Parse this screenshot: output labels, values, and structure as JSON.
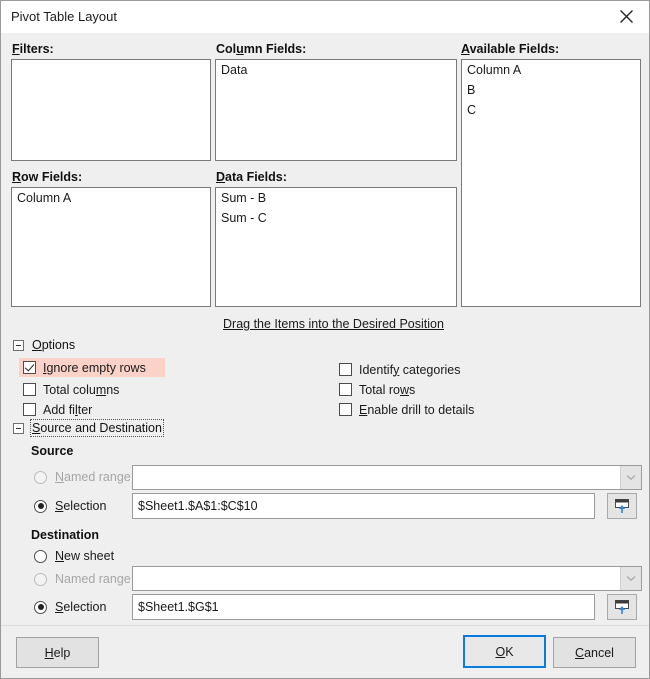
{
  "window": {
    "title": "Pivot Table Layout",
    "close_icon": "close-icon"
  },
  "layout_areas": {
    "filters": {
      "label": "Filters:",
      "label_mnemonic": "F",
      "items": []
    },
    "column_fields": {
      "label": "Column Fields:",
      "label_mnemonic": "u",
      "items": [
        "Data"
      ]
    },
    "available_fields": {
      "label": "Available Fields:",
      "label_mnemonic": "A",
      "items": [
        "Column A",
        "B",
        "C"
      ]
    },
    "row_fields": {
      "label": "Row Fields:",
      "label_mnemonic": "R",
      "items": [
        "Column A"
      ]
    },
    "data_fields": {
      "label": "Data Fields:",
      "label_mnemonic": "D",
      "items": [
        "Sum - B",
        "Sum - C"
      ]
    },
    "drag_hint": "Drag the Items into the Desired Position"
  },
  "options": {
    "section_label": "Options",
    "section_mnemonic": "O",
    "expanded": true,
    "highlight_color": "#fbd2c8",
    "left_column": [
      {
        "label": "Ignore empty rows",
        "mnemonic": "I",
        "checked": true,
        "highlighted": true
      },
      {
        "label": "Total columns",
        "mnemonic": "m",
        "checked": false,
        "highlighted": false
      },
      {
        "label": "Add filter",
        "mnemonic": "l",
        "checked": false,
        "highlighted": false
      }
    ],
    "right_column": [
      {
        "label": "Identify categories",
        "mnemonic": "y",
        "checked": false,
        "highlighted": false
      },
      {
        "label": "Total rows",
        "mnemonic": "w",
        "checked": false,
        "highlighted": false
      },
      {
        "label": "Enable drill to details",
        "mnemonic": "E",
        "checked": false,
        "highlighted": false
      }
    ]
  },
  "source_destination": {
    "section_label": "Source and Destination",
    "section_mnemonic": "S",
    "expanded": true,
    "focused": true,
    "source": {
      "heading": "Source",
      "named_range": {
        "label": "Named range",
        "mnemonic": "N",
        "selected": false,
        "disabled": true,
        "value": ""
      },
      "selection": {
        "label": "Selection",
        "mnemonic": "S",
        "selected": true,
        "disabled": false,
        "value": "$Sheet1.$A$1:$C$10"
      },
      "shrink_button_icon": "shrink-range-icon"
    },
    "destination": {
      "heading": "Destination",
      "new_sheet": {
        "label": "New sheet",
        "mnemonic": "N",
        "selected": false,
        "disabled": false
      },
      "named_range": {
        "label": "Named range",
        "mnemonic": "g",
        "selected": false,
        "disabled": true,
        "value": ""
      },
      "selection": {
        "label": "Selection",
        "mnemonic": "S",
        "selected": true,
        "disabled": false,
        "value": "$Sheet1.$G$1"
      },
      "shrink_button_icon": "shrink-range-icon"
    }
  },
  "buttons": {
    "help": {
      "label": "Help",
      "mnemonic": "H",
      "default": false
    },
    "ok": {
      "label": "OK",
      "mnemonic": "O",
      "default": true
    },
    "cancel": {
      "label": "Cancel",
      "mnemonic": "C",
      "default": false
    }
  }
}
